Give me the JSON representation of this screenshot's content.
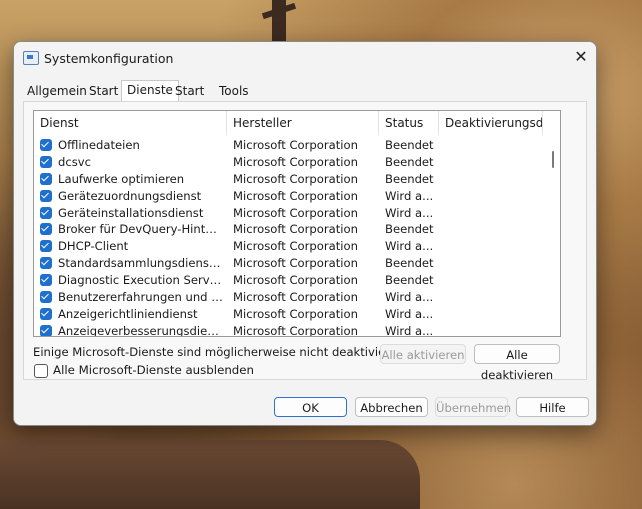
{
  "window": {
    "title": "Systemkonfiguration",
    "close_glyph": "✕"
  },
  "tabs": [
    {
      "label": "Allgemein"
    },
    {
      "label": "Start"
    },
    {
      "label": "Dienste"
    },
    {
      "label": "Start"
    },
    {
      "label": "Tools"
    }
  ],
  "list": {
    "headers": {
      "dienst": "Dienst",
      "hersteller": "Hersteller",
      "status": "Status",
      "deaktiviert": "Deaktivierungsd..."
    },
    "rows": [
      {
        "dienst": "Offlinedateien",
        "hersteller": "Microsoft Corporation",
        "status": "Beendet"
      },
      {
        "dienst": "dcsvc",
        "hersteller": "Microsoft Corporation",
        "status": "Beendet"
      },
      {
        "dienst": "Laufwerke optimieren",
        "hersteller": "Microsoft Corporation",
        "status": "Beendet"
      },
      {
        "dienst": "Gerätezuordnungsdienst",
        "hersteller": "Microsoft Corporation",
        "status": "Wird a..."
      },
      {
        "dienst": "Geräteinstallationsdienst",
        "hersteller": "Microsoft Corporation",
        "status": "Wird a..."
      },
      {
        "dienst": "Broker für DevQuery-Hintergrun...",
        "hersteller": "Microsoft Corporation",
        "status": "Beendet"
      },
      {
        "dienst": "DHCP-Client",
        "hersteller": "Microsoft Corporation",
        "status": "Wird a..."
      },
      {
        "dienst": "Standardsammlungsdienst des M...",
        "hersteller": "Microsoft Corporation",
        "status": "Beendet"
      },
      {
        "dienst": "Diagnostic Execution Service",
        "hersteller": "Microsoft Corporation",
        "status": "Beendet"
      },
      {
        "dienst": "Benutzererfahrungen und Telem...",
        "hersteller": "Microsoft Corporation",
        "status": "Wird a..."
      },
      {
        "dienst": "Anzeigerichtliniendienst",
        "hersteller": "Microsoft Corporation",
        "status": "Wird a..."
      },
      {
        "dienst": "Anzeigeverbesserungsdienst",
        "hersteller": "Microsoft Corporation",
        "status": "Wird a..."
      }
    ]
  },
  "note": "Einige Microsoft-Dienste sind möglicherweise nicht deaktiviert.",
  "buttons": {
    "enable_all": "Alle aktivieren",
    "disable_all": "Alle deaktivieren",
    "ok": "OK",
    "cancel": "Abbrechen",
    "apply": "Übernehmen",
    "help": "Hilfe"
  },
  "hide_ms_label": "Alle Microsoft-Dienste ausblenden",
  "colors": {
    "accent": "#1f6fcf",
    "primary_border": "#2a74d0"
  }
}
